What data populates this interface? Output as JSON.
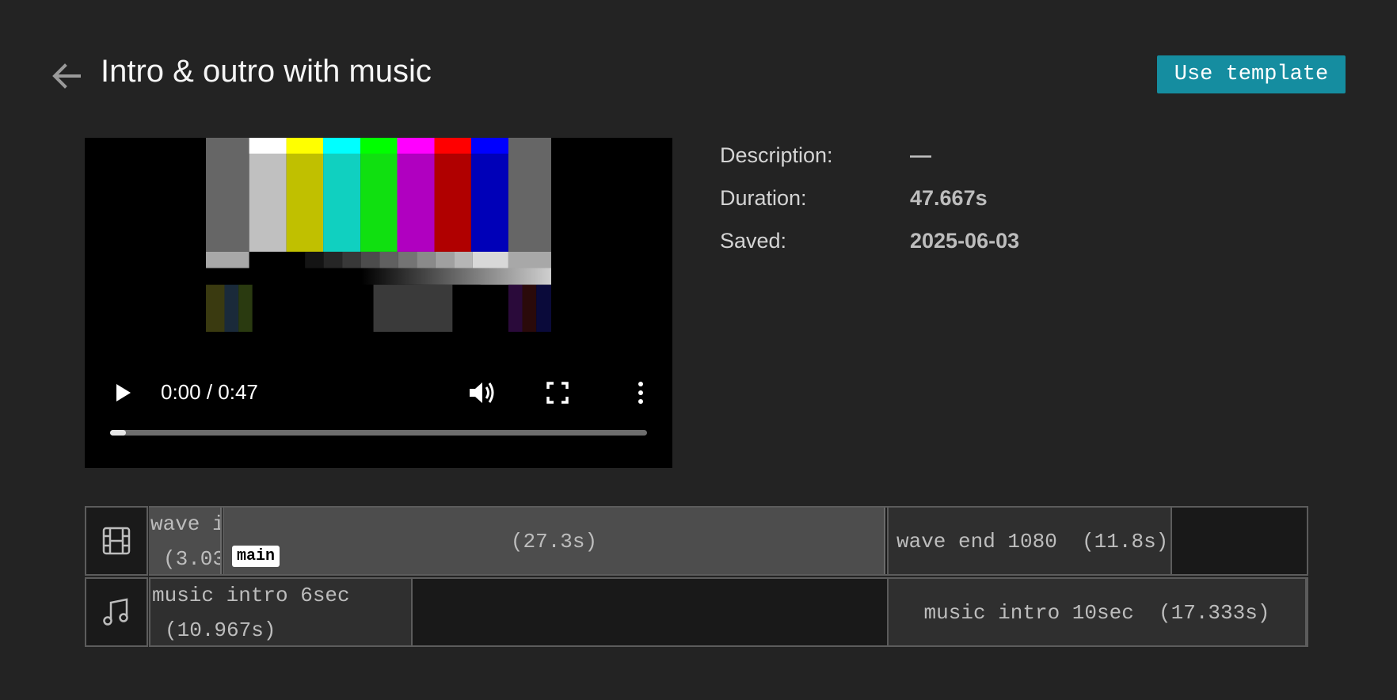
{
  "header": {
    "title": "Intro & outro with music",
    "back_icon": "arrow-left-icon",
    "use_template_label": "Use template"
  },
  "player": {
    "time_display": "0:00 / 0:47",
    "progress": 0.03,
    "icons": [
      "play-icon",
      "volume-icon",
      "fullscreen-icon",
      "more-vertical-icon"
    ]
  },
  "details": {
    "description_label": "Description:",
    "description_value": "—",
    "duration_label": "Duration:",
    "duration_value": "47.667s",
    "saved_label": "Saved:",
    "saved_value": "2025-06-03"
  },
  "timeline": {
    "video_track": {
      "icon": "film-icon",
      "clips": [
        {
          "name": "wave i",
          "duration": "(3.03"
        },
        {
          "name": "",
          "duration": "(27.3s)",
          "tag": "main"
        },
        {
          "name": "wave end 1080",
          "duration": "(11.8s)"
        }
      ]
    },
    "audio_track": {
      "icon": "music-note-icon",
      "clips": [
        {
          "name": "music intro 6sec",
          "duration": "(10.967s)"
        },
        {
          "name": "music intro 10sec",
          "duration": "(17.333s)"
        }
      ]
    }
  },
  "colors": {
    "background": "#232323",
    "accent": "#158da0",
    "clip_light": "#4d4d4d",
    "clip_dark": "#2f2f2f"
  }
}
